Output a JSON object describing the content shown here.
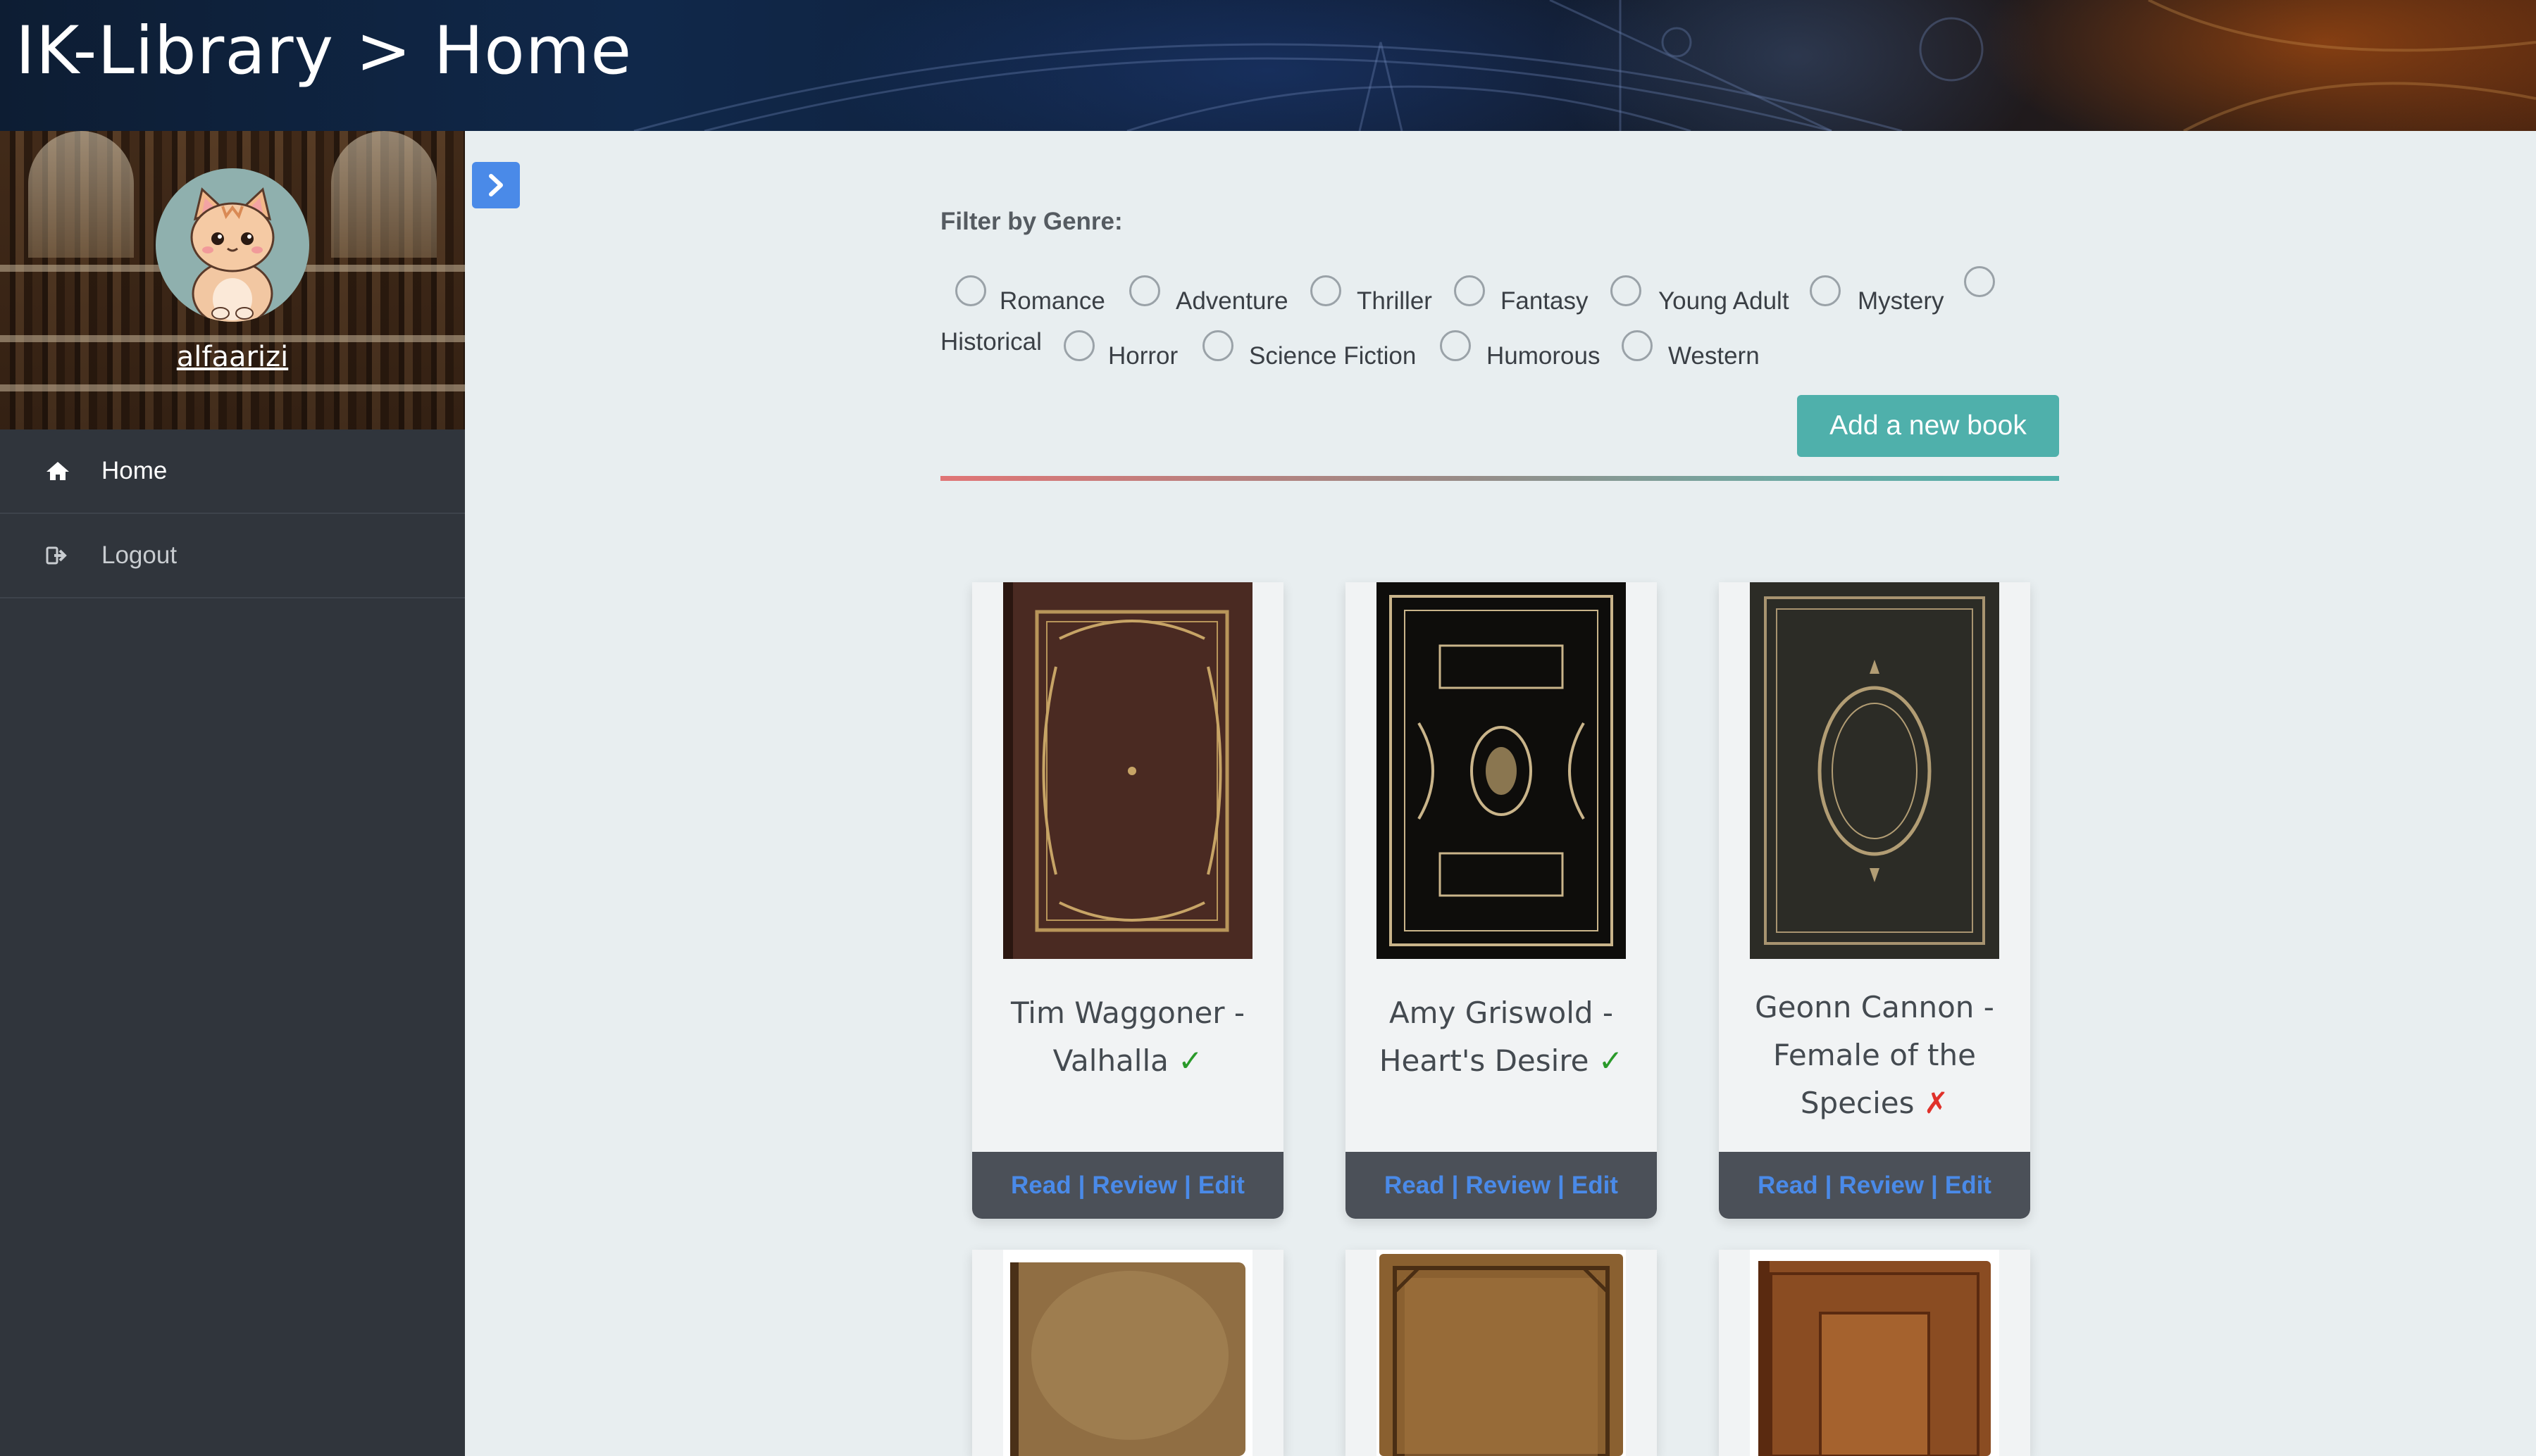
{
  "header": {
    "title": "IK-Library > Home"
  },
  "sidebar": {
    "username": "alfaarizi",
    "nav": [
      {
        "label": "Home",
        "icon": "home-icon"
      },
      {
        "label": "Logout",
        "icon": "logout-icon"
      }
    ],
    "toggle_icon": "chevron-right-icon"
  },
  "filter": {
    "title": "Filter by Genre:",
    "genres": [
      "Romance",
      "Adventure",
      "Thriller",
      "Fantasy",
      "Young Adult",
      "Mystery",
      "Historical",
      "Horror",
      "Science Fiction",
      "Humorous",
      "Western"
    ]
  },
  "add_button": "Add a new book",
  "actions": {
    "read": "Read",
    "review": "Review",
    "edit": "Edit",
    "separator": "|"
  },
  "books": [
    {
      "line1": "Tim Waggoner -",
      "line2": "Valhalla",
      "line3": "",
      "mark": "✓",
      "available": true
    },
    {
      "line1": "Amy Griswold -",
      "line2": "Heart's Desire",
      "line3": "",
      "mark": "✓",
      "available": true
    },
    {
      "line1": "Geonn Cannon -",
      "line2": "Female of the",
      "line3": "Species",
      "mark": "✗",
      "available": false
    }
  ],
  "colors": {
    "accent": "#4fb0ab",
    "link": "#4a8ae8",
    "sidebar": "#30353c",
    "available": "#2a9a2a",
    "unavailable": "#e0312a"
  }
}
